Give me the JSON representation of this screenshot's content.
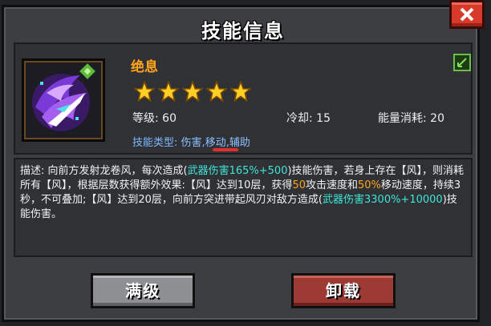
{
  "dialog": {
    "title": "技能信息"
  },
  "skill": {
    "name": "绝息",
    "stars": 5,
    "level_label": "等级: 60",
    "cooldown_label": "冷却: 15",
    "energy_label": "能量消耗: 20",
    "type_prefix": "技能类型:",
    "types": [
      "伤害",
      "移动",
      "辅助"
    ],
    "type_separator": ","
  },
  "description": {
    "seg1": "描述: 向前方发射龙卷风，每次造成(",
    "hl1": "武器伤害165%+500",
    "seg2": ")技能伤害，若身上存在【风】，则消耗所有【风】，根据层数获得额外效果:【风】达到10层，获得",
    "hl2": "50",
    "seg3": "攻击速度和",
    "hl3": "50%",
    "seg4": "移动速度，持续3秒，不可叠加;【风】达到20层，向前方突进带起风刃对敌方造成(",
    "hl4": "武器伤害3300%+10000",
    "seg5": ")技能伤害。"
  },
  "buttons": {
    "max_label": "满级",
    "unload_label": "卸载"
  },
  "colors": {
    "accent_orange": "#ffa319",
    "highlight_cyan": "#3fe6d8",
    "type_blue": "#8fc0ff"
  }
}
